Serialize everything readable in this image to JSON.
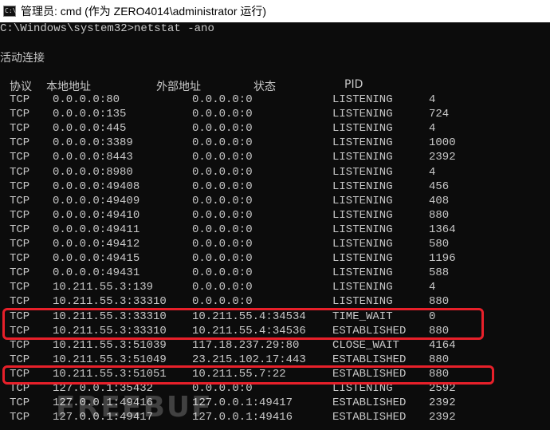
{
  "window": {
    "title": "管理员: cmd (作为 ZERO4014\\administrator 运行)",
    "icon": "C:\\"
  },
  "console": {
    "command_line": "C:\\Windows\\system32>netstat -ano",
    "section_title": "活动连接",
    "headers": {
      "proto": "协议",
      "local": "本地地址",
      "foreign": "外部地址",
      "state": "状态",
      "pid": "PID"
    },
    "rows": [
      {
        "proto": "TCP",
        "local": "0.0.0.0:80",
        "foreign": "0.0.0.0:0",
        "state": "LISTENING",
        "pid": "4"
      },
      {
        "proto": "TCP",
        "local": "0.0.0.0:135",
        "foreign": "0.0.0.0:0",
        "state": "LISTENING",
        "pid": "724"
      },
      {
        "proto": "TCP",
        "local": "0.0.0.0:445",
        "foreign": "0.0.0.0:0",
        "state": "LISTENING",
        "pid": "4"
      },
      {
        "proto": "TCP",
        "local": "0.0.0.0:3389",
        "foreign": "0.0.0.0:0",
        "state": "LISTENING",
        "pid": "1000"
      },
      {
        "proto": "TCP",
        "local": "0.0.0.0:8443",
        "foreign": "0.0.0.0:0",
        "state": "LISTENING",
        "pid": "2392"
      },
      {
        "proto": "TCP",
        "local": "0.0.0.0:8980",
        "foreign": "0.0.0.0:0",
        "state": "LISTENING",
        "pid": "4"
      },
      {
        "proto": "TCP",
        "local": "0.0.0.0:49408",
        "foreign": "0.0.0.0:0",
        "state": "LISTENING",
        "pid": "456"
      },
      {
        "proto": "TCP",
        "local": "0.0.0.0:49409",
        "foreign": "0.0.0.0:0",
        "state": "LISTENING",
        "pid": "408"
      },
      {
        "proto": "TCP",
        "local": "0.0.0.0:49410",
        "foreign": "0.0.0.0:0",
        "state": "LISTENING",
        "pid": "880"
      },
      {
        "proto": "TCP",
        "local": "0.0.0.0:49411",
        "foreign": "0.0.0.0:0",
        "state": "LISTENING",
        "pid": "1364"
      },
      {
        "proto": "TCP",
        "local": "0.0.0.0:49412",
        "foreign": "0.0.0.0:0",
        "state": "LISTENING",
        "pid": "580"
      },
      {
        "proto": "TCP",
        "local": "0.0.0.0:49415",
        "foreign": "0.0.0.0:0",
        "state": "LISTENING",
        "pid": "1196"
      },
      {
        "proto": "TCP",
        "local": "0.0.0.0:49431",
        "foreign": "0.0.0.0:0",
        "state": "LISTENING",
        "pid": "588"
      },
      {
        "proto": "TCP",
        "local": "10.211.55.3:139",
        "foreign": "0.0.0.0:0",
        "state": "LISTENING",
        "pid": "4"
      },
      {
        "proto": "TCP",
        "local": "10.211.55.3:33310",
        "foreign": "0.0.0.0:0",
        "state": "LISTENING",
        "pid": "880"
      },
      {
        "proto": "TCP",
        "local": "10.211.55.3:33310",
        "foreign": "10.211.55.4:34534",
        "state": "TIME_WAIT",
        "pid": "0"
      },
      {
        "proto": "TCP",
        "local": "10.211.55.3:33310",
        "foreign": "10.211.55.4:34536",
        "state": "ESTABLISHED",
        "pid": "880"
      },
      {
        "proto": "TCP",
        "local": "10.211.55.3:51039",
        "foreign": "117.18.237.29:80",
        "state": "CLOSE_WAIT",
        "pid": "4164"
      },
      {
        "proto": "TCP",
        "local": "10.211.55.3:51049",
        "foreign": "23.215.102.17:443",
        "state": "ESTABLISHED",
        "pid": "880"
      },
      {
        "proto": "TCP",
        "local": "10.211.55.3:51051",
        "foreign": "10.211.55.7:22",
        "state": "ESTABLISHED",
        "pid": "880"
      },
      {
        "proto": "TCP",
        "local": "127.0.0.1:35432",
        "foreign": "0.0.0.0:0",
        "state": "LISTENING",
        "pid": "2592"
      },
      {
        "proto": "TCP",
        "local": "127.0.0.1:49416",
        "foreign": "127.0.0.1:49417",
        "state": "ESTABLISHED",
        "pid": "2392"
      },
      {
        "proto": "TCP",
        "local": "127.0.0.1:49417",
        "foreign": "127.0.0.1:49416",
        "state": "ESTABLISHED",
        "pid": "2392"
      }
    ]
  },
  "highlight": {
    "color": "#e8202a"
  },
  "watermark": "FREEBUF"
}
